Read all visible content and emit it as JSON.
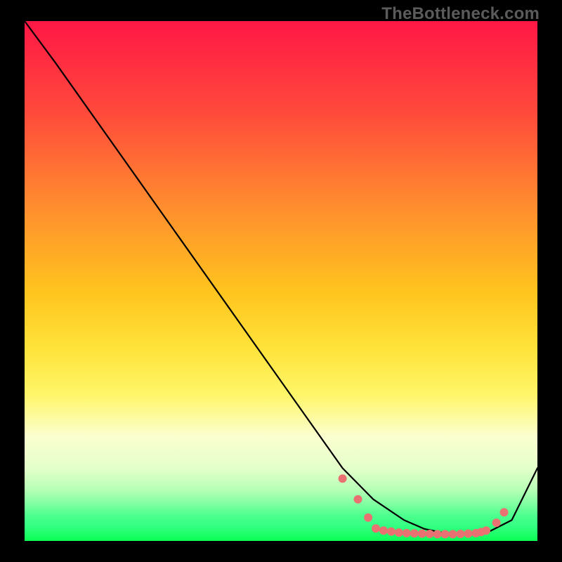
{
  "watermark": "TheBottleneck.com",
  "chart_data": {
    "type": "line",
    "title": "",
    "xlabel": "",
    "ylabel": "",
    "xlim": [
      0,
      100
    ],
    "ylim": [
      0,
      100
    ],
    "grid": false,
    "series": [
      {
        "name": "curve",
        "color": "#000000",
        "x": [
          0,
          6,
          62,
          68,
          74,
          78,
          82,
          86,
          90,
          95,
          100
        ],
        "y": [
          100,
          92,
          14,
          8,
          4,
          2.3,
          1.5,
          1.3,
          1.5,
          4,
          14
        ]
      }
    ],
    "markers": {
      "name": "dotted-flat",
      "color": "#e97171",
      "radius_px": 6,
      "x": [
        62,
        65,
        67,
        68.5,
        70,
        71.5,
        73,
        74.5,
        76,
        77.5,
        79,
        80.5,
        82,
        83.5,
        85,
        86.5,
        88,
        89,
        90,
        92,
        93.5
      ],
      "y": [
        12,
        8,
        4.5,
        2.4,
        2.0,
        1.8,
        1.6,
        1.5,
        1.45,
        1.4,
        1.35,
        1.3,
        1.3,
        1.3,
        1.35,
        1.4,
        1.5,
        1.7,
        2.0,
        3.5,
        5.5
      ]
    },
    "gradient_stops": [
      {
        "pos": 0.0,
        "color": "#ff1746"
      },
      {
        "pos": 0.18,
        "color": "#ff4b3b"
      },
      {
        "pos": 0.36,
        "color": "#ff8e2e"
      },
      {
        "pos": 0.52,
        "color": "#ffc41e"
      },
      {
        "pos": 0.63,
        "color": "#ffe33a"
      },
      {
        "pos": 0.72,
        "color": "#fff66a"
      },
      {
        "pos": 0.8,
        "color": "#fbffd0"
      },
      {
        "pos": 0.86,
        "color": "#e4ffca"
      },
      {
        "pos": 0.9,
        "color": "#b9ffb7"
      },
      {
        "pos": 0.93,
        "color": "#7effa1"
      },
      {
        "pos": 0.95,
        "color": "#4eff8e"
      },
      {
        "pos": 0.97,
        "color": "#36ff84"
      },
      {
        "pos": 1.0,
        "color": "#0aff54"
      }
    ]
  }
}
